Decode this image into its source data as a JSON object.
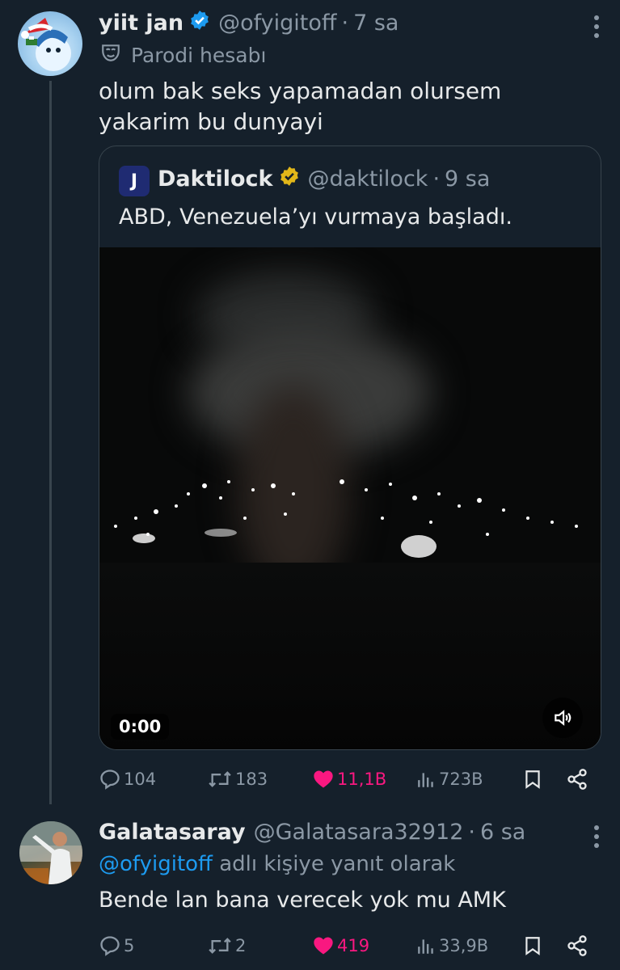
{
  "tweet": {
    "display_name": "yiit jan",
    "handle": "@ofyigitoff",
    "separator": "·",
    "time": "7 sa",
    "parody_label": "Parodi hesabı",
    "text": "olum bak seks yapamadan olursem yakarim bu dunyayi",
    "verified_color": "#1d9bf0"
  },
  "quote": {
    "avatar_text": "J",
    "display_name": "Daktilock",
    "handle": "@daktilock",
    "separator": "·",
    "time": "9 sa",
    "text": "ABD, Venezuela’yı vurmaya başladı.",
    "verified_color": "#e2b719",
    "video": {
      "timecode": "0:00"
    }
  },
  "tweet_actions": {
    "replies": "104",
    "reposts": "183",
    "likes": "11,1B",
    "views": "723B",
    "like_color": "#f91880"
  },
  "reply": {
    "display_name": "Galatasaray",
    "handle": "@Galatasara32912",
    "separator": "·",
    "time": "6 sa",
    "reply_mention": "@ofyigitoff",
    "reply_suffix": "adlı kişiye yanıt olarak",
    "text": "Bende lan bana verecek yok mu AMK"
  },
  "reply_actions": {
    "replies": "5",
    "reposts": "2",
    "likes": "419",
    "views": "33,9B"
  },
  "colors": {
    "background": "#15202b",
    "secondary_text": "#8b98a5",
    "accent": "#1d9bf0"
  }
}
